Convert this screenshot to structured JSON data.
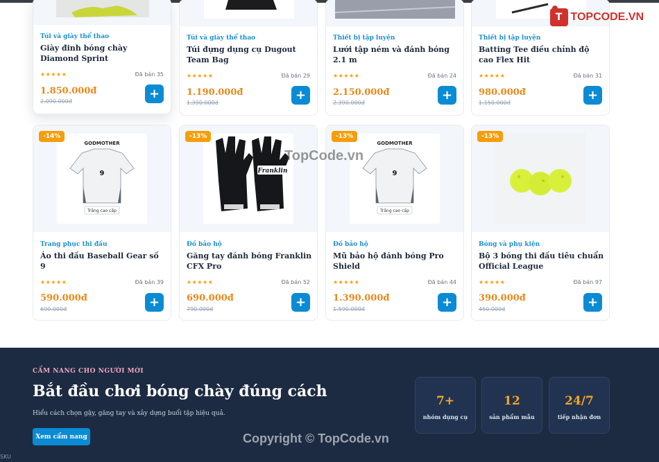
{
  "watermark": {
    "logo_mark": "T",
    "logo_text": "TOPCODE.VN",
    "center_text": "TopCode.vn"
  },
  "products_row1": [
    {
      "category": "Túi và giày thể thao",
      "title": "Giày đinh bóng chày Diamond Sprint",
      "rating": "★★★★★",
      "sold": "Đã bán 35",
      "price": "1.850.000đ",
      "old_price": "2.090.000đ",
      "add_label": "+"
    },
    {
      "category": "Túi và giày thể thao",
      "title": "Túi đựng dụng cụ Dugout Team Bag",
      "rating": "★★★★★",
      "sold": "Đã bán 29",
      "price": "1.190.000đ",
      "old_price": "1.390.000đ",
      "add_label": "+"
    },
    {
      "category": "Thiết bị tập luyện",
      "title": "Lưới tập ném và đánh bóng 2.1 m",
      "rating": "★★★★★",
      "sold": "Đã bán 24",
      "price": "2.150.000đ",
      "old_price": "2.390.000đ",
      "add_label": "+"
    },
    {
      "category": "Thiết bị tập luyện",
      "title": "Batting Tee điều chỉnh độ cao Flex Hit",
      "rating": "★★★★★",
      "sold": "Đã bán 31",
      "price": "980.000đ",
      "old_price": "1.150.000đ",
      "add_label": "+"
    }
  ],
  "products_row2": [
    {
      "badge": "-14%",
      "category": "Trang phục thi đấu",
      "title": "Áo thi đấu Baseball Gear số 9",
      "rating": "★★★★★",
      "sold": "Đã bán 39",
      "price": "590.000đ",
      "old_price": "690.000đ",
      "add_label": "+",
      "image": {
        "brand": "GODMOTHER",
        "number": "9",
        "caption": "Trắng cao cấp"
      }
    },
    {
      "badge": "-13%",
      "category": "Đồ bảo hộ",
      "title": "Găng tay đánh bóng Franklin CFX Pro",
      "rating": "★★★★★",
      "sold": "Đã bán 52",
      "price": "690.000đ",
      "old_price": "790.000đ",
      "add_label": "+",
      "image": {
        "brand": "Franklin"
      }
    },
    {
      "badge": "-13%",
      "category": "Đồ bảo hộ",
      "title": "Mũ bảo hộ đánh bóng Pro Shield",
      "rating": "★★★★★",
      "sold": "Đã bán 44",
      "price": "1.390.000đ",
      "old_price": "1.590.000đ",
      "add_label": "+",
      "image": {
        "brand": "GODMOTHER",
        "number": "9",
        "caption": "Trắng cao cấp"
      }
    },
    {
      "badge": "-13%",
      "category": "Bóng và phụ kiện",
      "title": "Bộ 3 bóng thi đấu tiêu chuẩn Official League",
      "rating": "★★★★★",
      "sold": "Đã bán 97",
      "price": "390.000đ",
      "old_price": "450.000đ",
      "add_label": "+"
    }
  ],
  "footer": {
    "kicker": "CẨM NANG CHO NGƯỜI MỚI",
    "title": "Bắt đầu chơi bóng chày đúng cách",
    "subtitle": "Hiểu cách chọn gậy, găng tay và xây dựng buổi tập hiệu quả.",
    "button": "Xem cẩm nang",
    "stats": [
      {
        "value": "7+",
        "label": "nhóm dụng cụ"
      },
      {
        "value": "12",
        "label": "sản phẩm mẫu"
      },
      {
        "value": "24/7",
        "label": "tiếp nhận đơn"
      }
    ],
    "copyright": "Copyright © TopCode.vn",
    "corner_text": "SKU"
  },
  "colors": {
    "accent": "#0b8bd4",
    "price": "#e8891a",
    "badge": "#f59e0b",
    "footer_bg": "#1c2b42",
    "category": "#1b8fd1"
  }
}
